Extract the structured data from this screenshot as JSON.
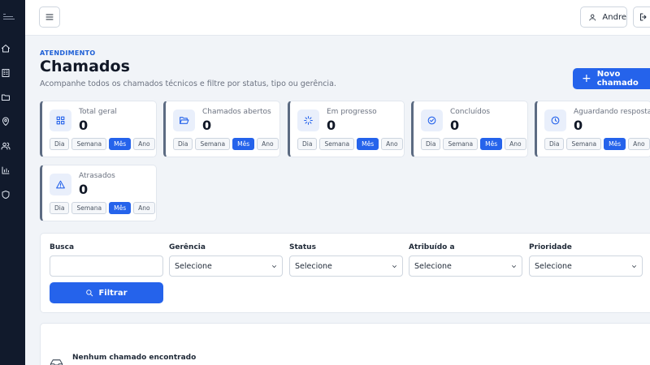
{
  "topbar": {
    "user_name": "Andre"
  },
  "header": {
    "eyebrow": "ATENDIMENTO",
    "title": "Chamados",
    "subtitle": "Acompanhe todos os chamados técnicos e filtre por status, tipo ou gerência.",
    "new_button": "Novo chamado"
  },
  "periods": [
    "Dia",
    "Semana",
    "Mês",
    "Ano"
  ],
  "active_period": "Mês",
  "stats": [
    {
      "label": "Total geral",
      "value": "0",
      "icon": "grid-icon"
    },
    {
      "label": "Chamados abertos",
      "value": "0",
      "icon": "folder-open-icon"
    },
    {
      "label": "Em progresso",
      "value": "0",
      "icon": "spinner-icon"
    },
    {
      "label": "Concluídos",
      "value": "0",
      "icon": "check-circle-icon"
    },
    {
      "label": "Aguardando resposta",
      "value": "0",
      "icon": "clock-icon"
    },
    {
      "label": "Atrasados",
      "value": "0",
      "icon": "warning-icon"
    }
  ],
  "filters": {
    "search_label": "Busca",
    "search_value": "",
    "gerencia_label": "Gerência",
    "gerencia_value": "Selecione",
    "status_label": "Status",
    "status_value": "Selecione",
    "atribuido_label": "Atribuído a",
    "atribuido_value": "Selecione",
    "prioridade_label": "Prioridade",
    "prioridade_value": "Selecione",
    "filter_button": "Filtrar"
  },
  "empty_state": {
    "text": "Nenhum chamado encontrado"
  },
  "colors": {
    "accent": "#2563eb",
    "sidebar": "#111a2c",
    "background": "#f1f4f8"
  }
}
